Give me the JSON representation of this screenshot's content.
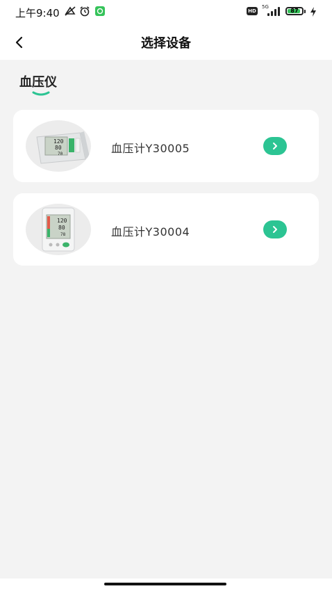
{
  "status_bar": {
    "time": "上午9:40",
    "battery_level": "87",
    "network": "5G",
    "hd_label": "HD"
  },
  "nav": {
    "title": "选择设备"
  },
  "section": {
    "title": "血压仪"
  },
  "devices": [
    {
      "name": "血压计Y30005",
      "display_values": [
        "120",
        "80",
        "70"
      ]
    },
    {
      "name": "血压计Y30004",
      "display_values": [
        "120",
        "80",
        "78"
      ]
    }
  ],
  "colors": {
    "accent": "#2cc493",
    "background": "#f3f3f3",
    "card": "#ffffff"
  }
}
